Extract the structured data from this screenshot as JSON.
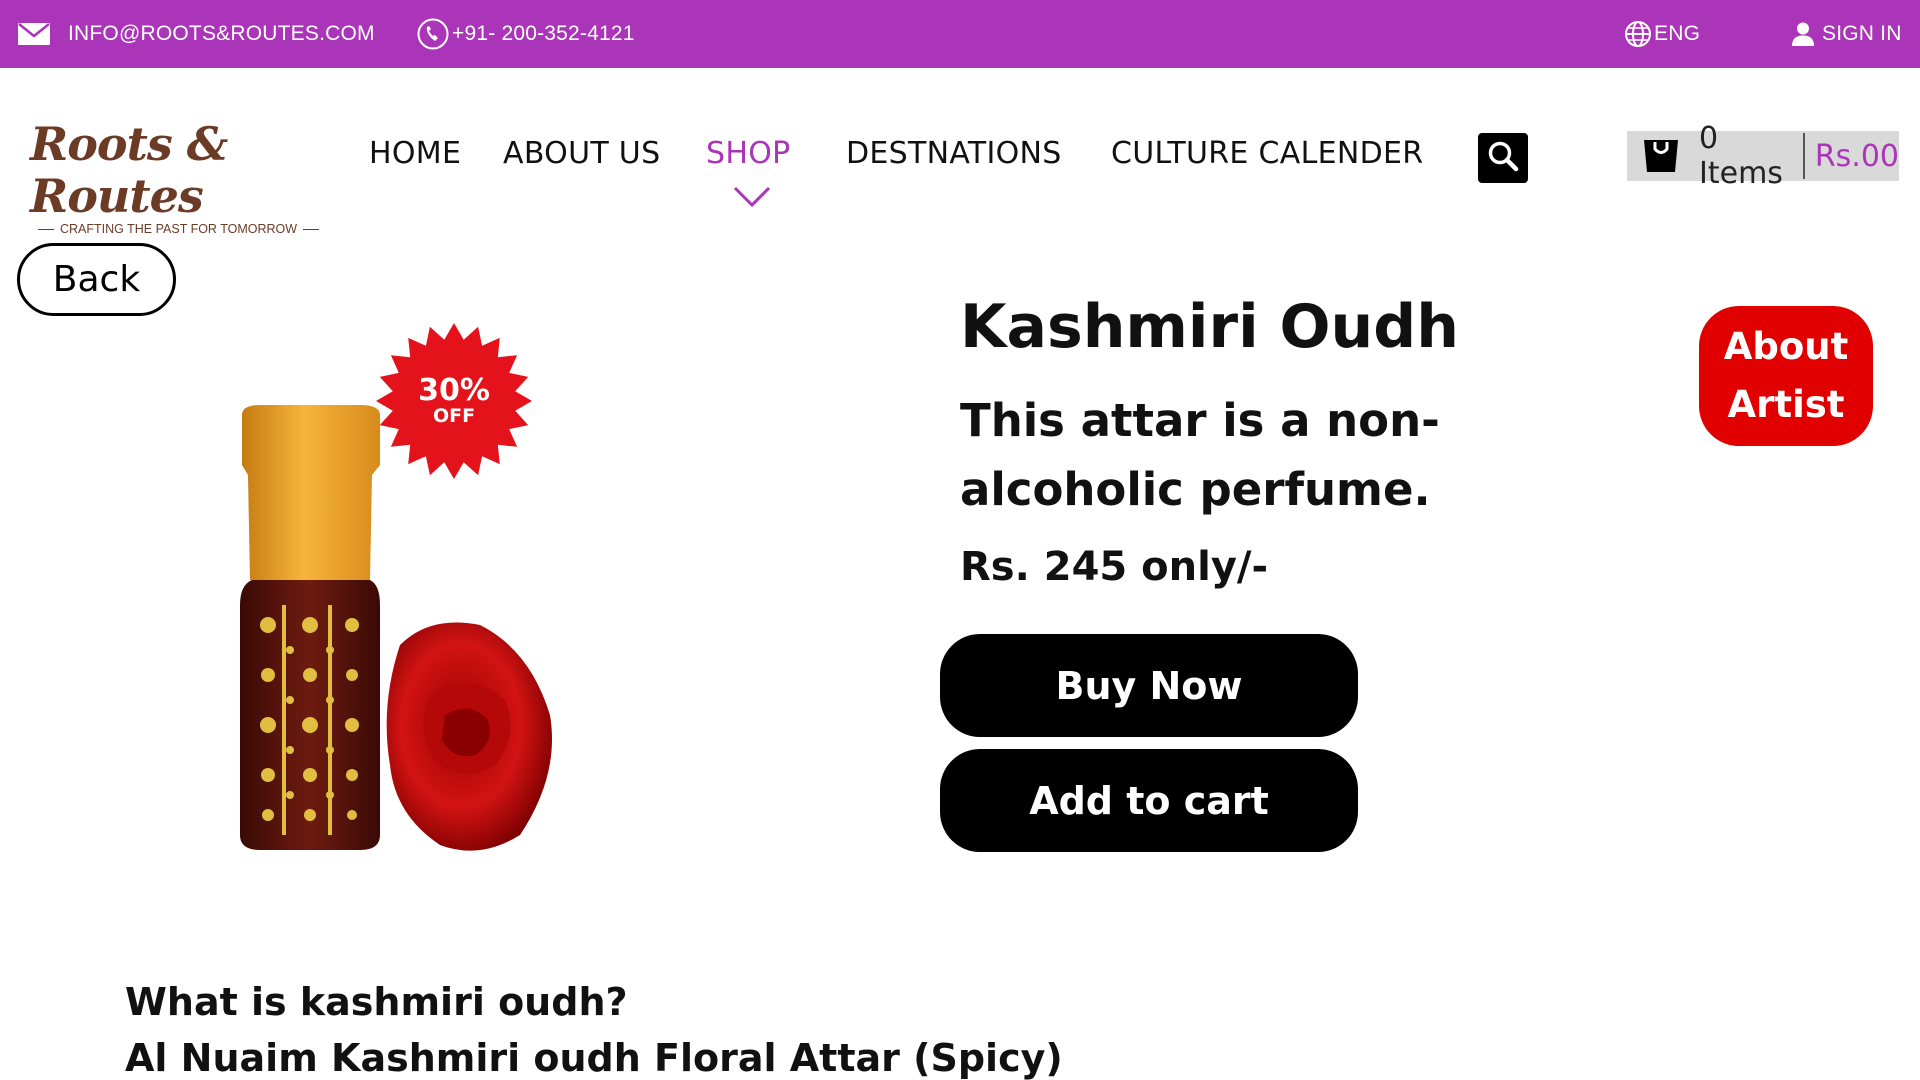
{
  "topbar": {
    "email": "INFO@ROOTS&ROUTES.COM",
    "phone": "+91- 200-352-4121",
    "language": "ENG",
    "signin": "SIGN IN",
    "email_icon": "mail-icon",
    "phone_icon": "phone-icon",
    "language_icon": "globe-icon",
    "signin_icon": "user-icon"
  },
  "brand": {
    "name": "Roots & Routes",
    "tagline": "CRAFTING THE PAST FOR TOMORROW",
    "color": "#6b3b26"
  },
  "nav": {
    "items": [
      "HOME",
      "ABOUT US",
      "SHOP",
      "DESTNATIONS",
      "CULTURE CALENDER"
    ],
    "active": "SHOP",
    "accent": "#ab35b8"
  },
  "cart": {
    "count_label": "0 Items",
    "total": "Rs.00",
    "icon": "shopping-bag-icon"
  },
  "back_label": "Back",
  "product": {
    "name": "Kashmiri Oudh",
    "subtitle": "This attar is a non-alcoholic perfume.",
    "price": "Rs. 245 only/-",
    "badge_percent": "30%",
    "badge_text": "OFF",
    "buy_label": "Buy Now",
    "add_cart_label": "Add to cart",
    "about_artist_line1": "About",
    "about_artist_line2": "Artist"
  },
  "description": {
    "question": "What is kashmiri oudh?",
    "line": "Al Nuaim Kashmiri oudh Floral Attar (Spicy)"
  },
  "colors": {
    "topbar": "#ab35b8",
    "about_artist": "#e00000",
    "badge": "#e3121b"
  }
}
